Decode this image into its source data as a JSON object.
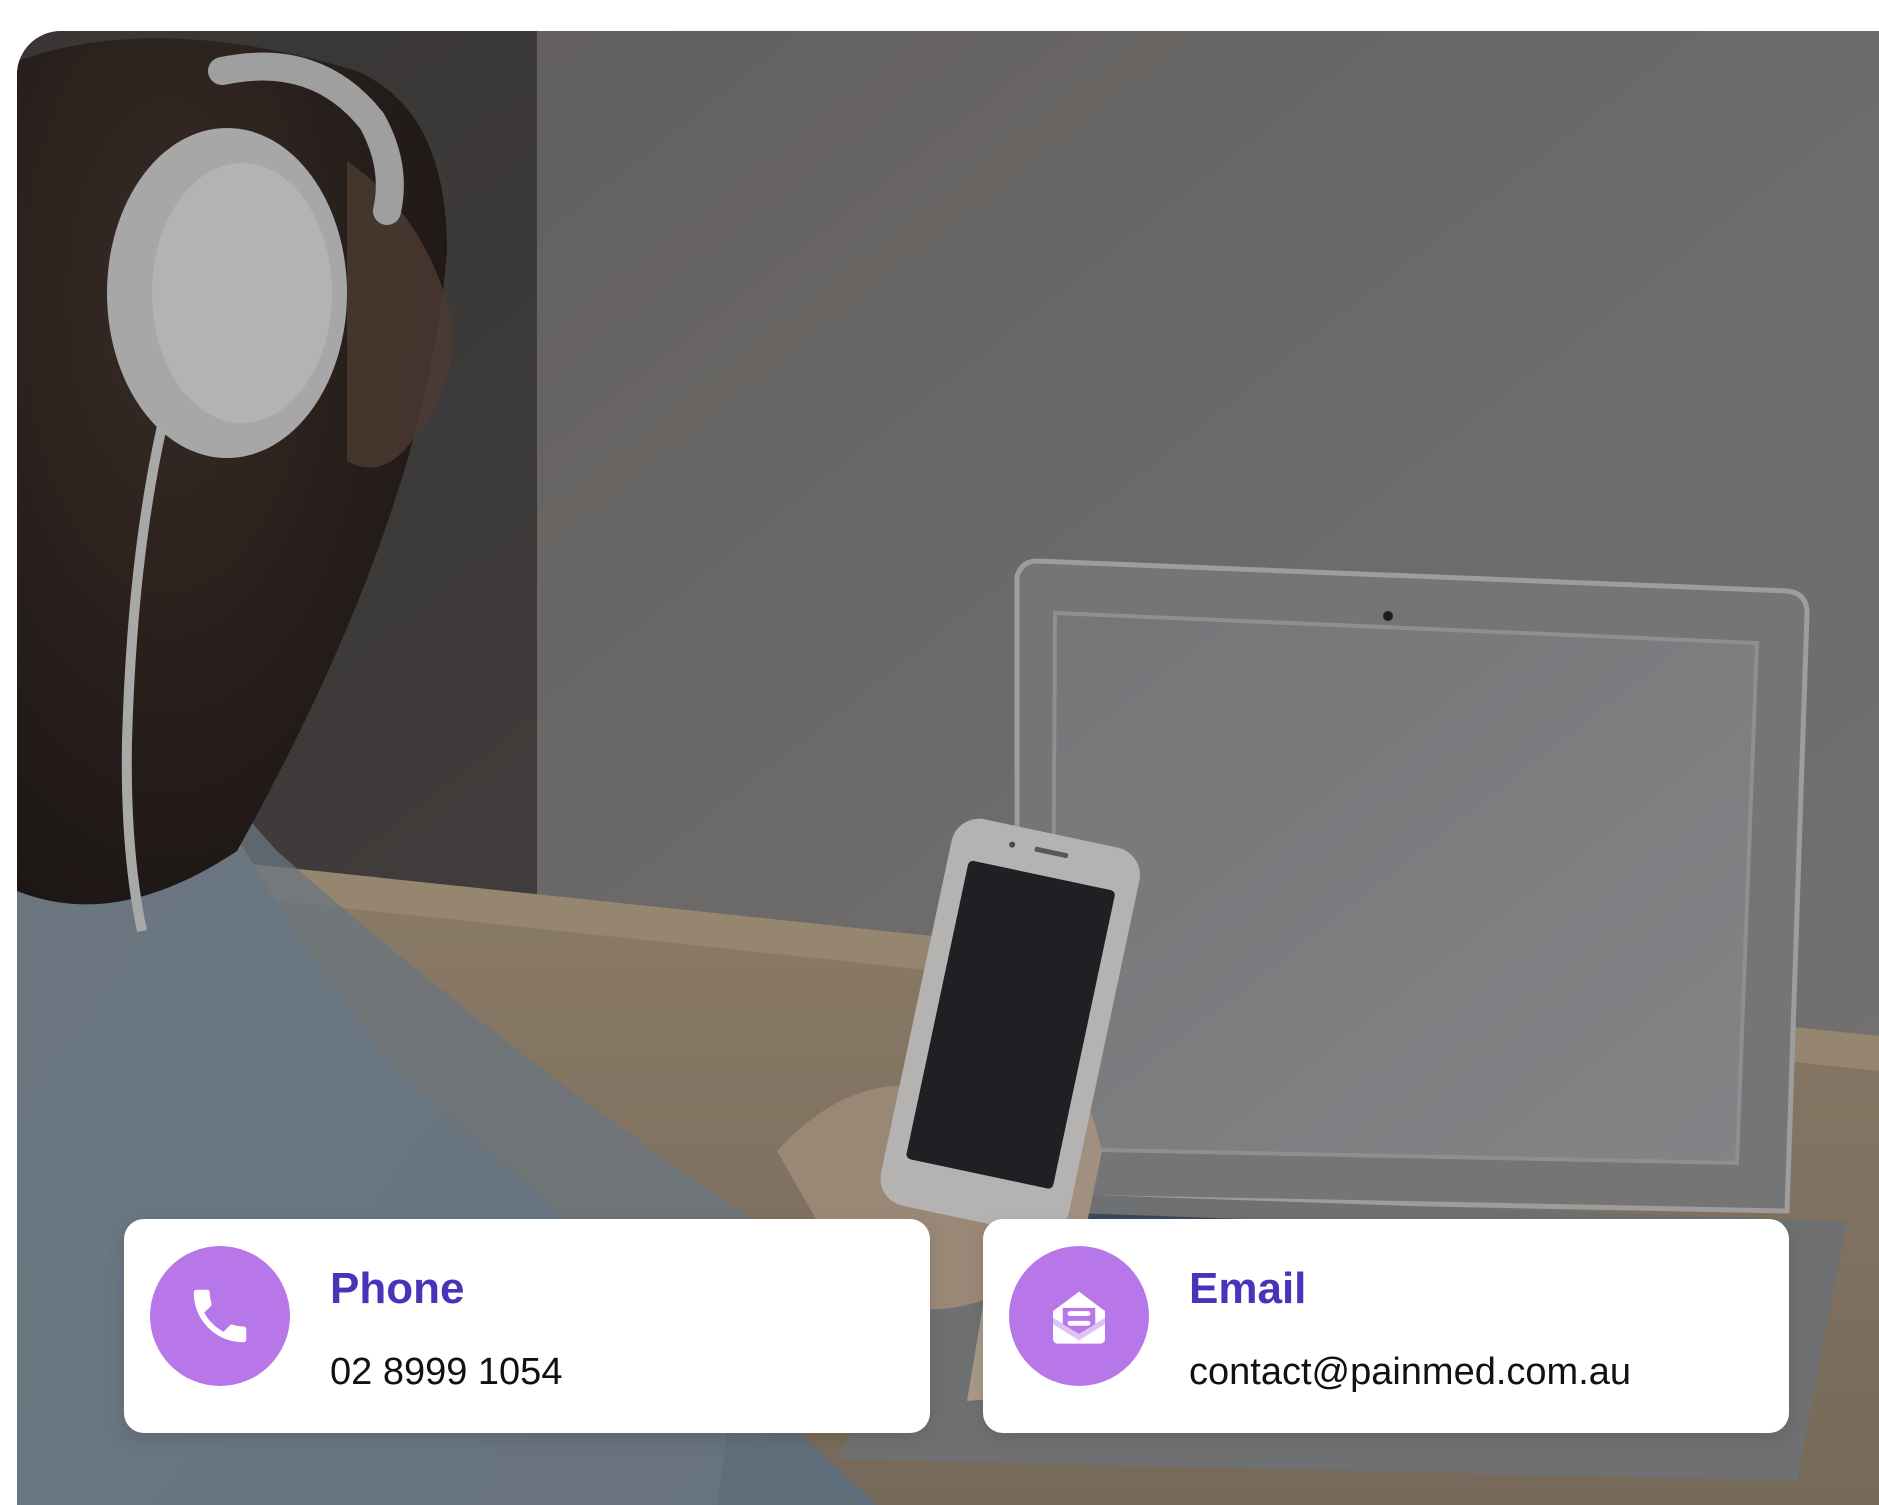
{
  "hero": {
    "image_subject": "person-with-headphones-using-phone-and-laptop"
  },
  "contact_cards": {
    "phone": {
      "title": "Phone",
      "value": "02 8999 1054",
      "icon": "phone-icon"
    },
    "email": {
      "title": "Email",
      "value": "contact@painmed.com.au",
      "icon": "email-icon"
    }
  },
  "colors": {
    "icon_background": "#b877e8",
    "title_text": "#4b32b8",
    "value_text": "#111111",
    "card_background": "#ffffff"
  }
}
